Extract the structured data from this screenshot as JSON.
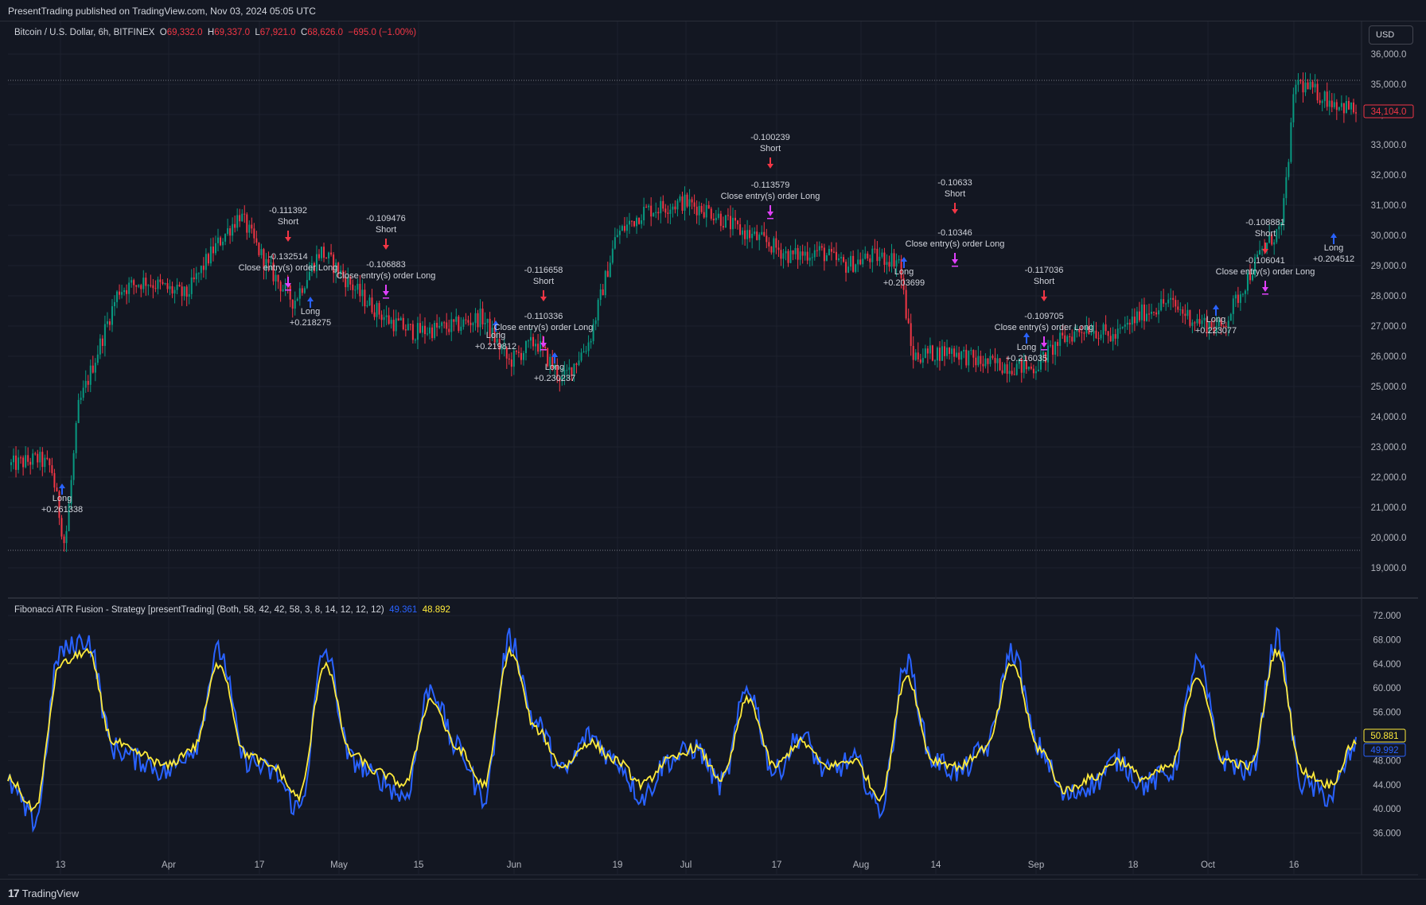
{
  "header": {
    "published": "PresentTrading published on TradingView.com, Nov 03, 2024 05:05 UTC"
  },
  "symbol": {
    "name": "Bitcoin / U.S. Dollar, 6h, BITFINEX",
    "o_label": "O",
    "o": "69,332.0",
    "h_label": "H",
    "h": "69,337.0",
    "l_label": "L",
    "l": "67,921.0",
    "c_label": "C",
    "c": "68,626.0",
    "change": "−695.0 (−1.00%)"
  },
  "currency": "USD",
  "indicator": {
    "name": "Fibonacci ATR Fusion - Strategy [presentTrading] (Both, 58, 42, 42, 58, 3, 8, 14, 12, 12, 12)",
    "value1": "49.361",
    "value2": "48.892"
  },
  "price_axis": [
    "36,000.0",
    "35,000.0",
    "34,000.0",
    "33,000.0",
    "32,000.0",
    "31,000.0",
    "30,000.0",
    "29,000.0",
    "28,000.0",
    "27,000.0",
    "26,000.0",
    "25,000.0",
    "24,000.0",
    "23,000.0",
    "22,000.0",
    "21,000.0",
    "20,000.0",
    "19,000.0"
  ],
  "price_tag": "34,104.0",
  "osc_axis": [
    "72.000",
    "68.000",
    "64.000",
    "60.000",
    "56.000",
    "52.000",
    "48.000",
    "44.000",
    "40.000",
    "36.000"
  ],
  "osc_tags": {
    "yellow": "50.881",
    "blue": "49.992"
  },
  "time_axis": [
    "13",
    "Apr",
    "17",
    "May",
    "15",
    "Jun",
    "19",
    "Jul",
    "17",
    "Aug",
    "14",
    "Sep",
    "18",
    "Oct",
    "16"
  ],
  "trades": [
    {
      "kind": "long",
      "label": "Long",
      "value": "+0.261338"
    },
    {
      "kind": "short",
      "label": "Short",
      "value": "-0.111392"
    },
    {
      "kind": "close",
      "label": "Close entry(s) order Long",
      "value": "-0.132514"
    },
    {
      "kind": "long",
      "label": "Long",
      "value": "+0.218275"
    },
    {
      "kind": "short",
      "label": "Short",
      "value": "-0.109476"
    },
    {
      "kind": "close",
      "label": "Close entry(s) order Long",
      "value": "-0.106883"
    },
    {
      "kind": "long",
      "label": "Long",
      "value": "+0.219812"
    },
    {
      "kind": "short",
      "label": "Short",
      "value": "-0.116658"
    },
    {
      "kind": "close",
      "label": "Close entry(s) order Long",
      "value": "-0.110336"
    },
    {
      "kind": "long",
      "label": "Long",
      "value": "+0.230237"
    },
    {
      "kind": "short",
      "label": "Short",
      "value": "-0.100239"
    },
    {
      "kind": "close",
      "label": "Close entry(s) order Long",
      "value": "-0.113579"
    },
    {
      "kind": "long",
      "label": "Long",
      "value": "+0.203699"
    },
    {
      "kind": "short",
      "label": "Short",
      "value": "-0.10633"
    },
    {
      "kind": "close",
      "label": "Close entry(s) order Long",
      "value": "-0.10346"
    },
    {
      "kind": "short",
      "label": "Short",
      "value": "-0.117036"
    },
    {
      "kind": "close",
      "label": "Close entry(s) order Long",
      "value": "-0.109705"
    },
    {
      "kind": "long",
      "label": "Long",
      "value": "+0.216035"
    },
    {
      "kind": "long",
      "label": "Long",
      "value": "+0.223077"
    },
    {
      "kind": "short",
      "label": "Short",
      "value": "-0.108881"
    },
    {
      "kind": "close",
      "label": "Close entry(s) order Long",
      "value": "-0.106041"
    },
    {
      "kind": "long",
      "label": "Long",
      "value": "+0.204512"
    }
  ],
  "chart_data": {
    "type": "candlestick",
    "price_range": [
      19000,
      36000
    ],
    "osc_range": [
      36,
      72
    ],
    "path": [
      [
        0,
        22400
      ],
      [
        0.02,
        22600
      ],
      [
        0.03,
        22300
      ],
      [
        0.04,
        19700
      ],
      [
        0.05,
        24300
      ],
      [
        0.08,
        28200
      ],
      [
        0.1,
        28500
      ],
      [
        0.13,
        28000
      ],
      [
        0.15,
        29500
      ],
      [
        0.17,
        30700
      ],
      [
        0.19,
        29000
      ],
      [
        0.21,
        27800
      ],
      [
        0.23,
        29500
      ],
      [
        0.26,
        28000
      ],
      [
        0.28,
        27200
      ],
      [
        0.3,
        26800
      ],
      [
        0.33,
        27000
      ],
      [
        0.35,
        27300
      ],
      [
        0.37,
        25800
      ],
      [
        0.39,
        26500
      ],
      [
        0.41,
        25200
      ],
      [
        0.43,
        26500
      ],
      [
        0.45,
        30000
      ],
      [
        0.47,
        30800
      ],
      [
        0.5,
        31100
      ],
      [
        0.52,
        30800
      ],
      [
        0.54,
        30200
      ],
      [
        0.56,
        29800
      ],
      [
        0.58,
        29300
      ],
      [
        0.6,
        29500
      ],
      [
        0.62,
        29000
      ],
      [
        0.64,
        29300
      ],
      [
        0.66,
        29200
      ],
      [
        0.67,
        26000
      ],
      [
        0.7,
        26200
      ],
      [
        0.72,
        25800
      ],
      [
        0.74,
        25700
      ],
      [
        0.76,
        25600
      ],
      [
        0.78,
        26500
      ],
      [
        0.8,
        27000
      ],
      [
        0.82,
        26600
      ],
      [
        0.84,
        27400
      ],
      [
        0.86,
        27800
      ],
      [
        0.88,
        27200
      ],
      [
        0.9,
        26900
      ],
      [
        0.915,
        28200
      ],
      [
        0.93,
        29500
      ],
      [
        0.945,
        30300
      ],
      [
        0.955,
        35100
      ],
      [
        0.975,
        34600
      ],
      [
        1.0,
        34100
      ]
    ],
    "osc_blue": [
      44,
      38,
      66,
      68,
      50,
      48,
      46,
      50,
      66,
      48,
      46,
      40,
      66,
      48,
      45,
      42,
      60,
      50,
      42,
      68,
      54,
      46,
      52,
      48,
      42,
      48,
      50,
      44,
      60,
      46,
      52,
      46,
      48,
      40,
      64,
      48,
      46,
      50,
      66,
      50,
      42,
      44,
      48,
      44,
      46,
      64,
      48,
      46,
      68,
      44,
      42,
      50
    ],
    "osc_yellow": [
      45,
      40,
      64,
      66,
      51,
      49,
      47,
      50,
      64,
      49,
      47,
      42,
      64,
      49,
      46,
      44,
      58,
      50,
      44,
      66,
      53,
      47,
      51,
      48,
      44,
      48,
      50,
      45,
      58,
      47,
      51,
      47,
      48,
      42,
      62,
      48,
      47,
      50,
      64,
      50,
      43,
      45,
      48,
      45,
      47,
      62,
      48,
      47,
      66,
      46,
      44,
      51
    ]
  }
}
